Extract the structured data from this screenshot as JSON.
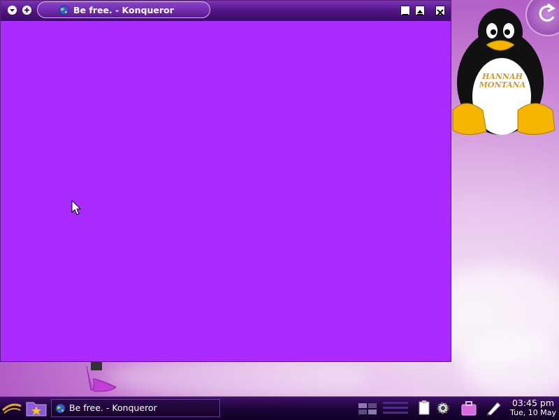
{
  "window": {
    "title": "Be free. - Konqueror",
    "content_color": "#a92bff",
    "buttons": [
      "menu-arrow",
      "sticky-plus",
      "minimize",
      "maximize",
      "close"
    ]
  },
  "taskbar": {
    "task_title": "Be free. - Konqueror",
    "clock": {
      "time": "03:45 pm",
      "date": "Tue, 10 May"
    }
  },
  "desktop": {
    "icons": [
      "tux-penguin-icon",
      "hannah-montana-logo",
      "pink-heels-icon"
    ],
    "mascot_shirt_text": [
      "HANNAH",
      "MONTANA"
    ]
  },
  "colors": {
    "accent": "#a92bff",
    "titlebar": "#4e1580",
    "taskbar": "#1d0437"
  }
}
